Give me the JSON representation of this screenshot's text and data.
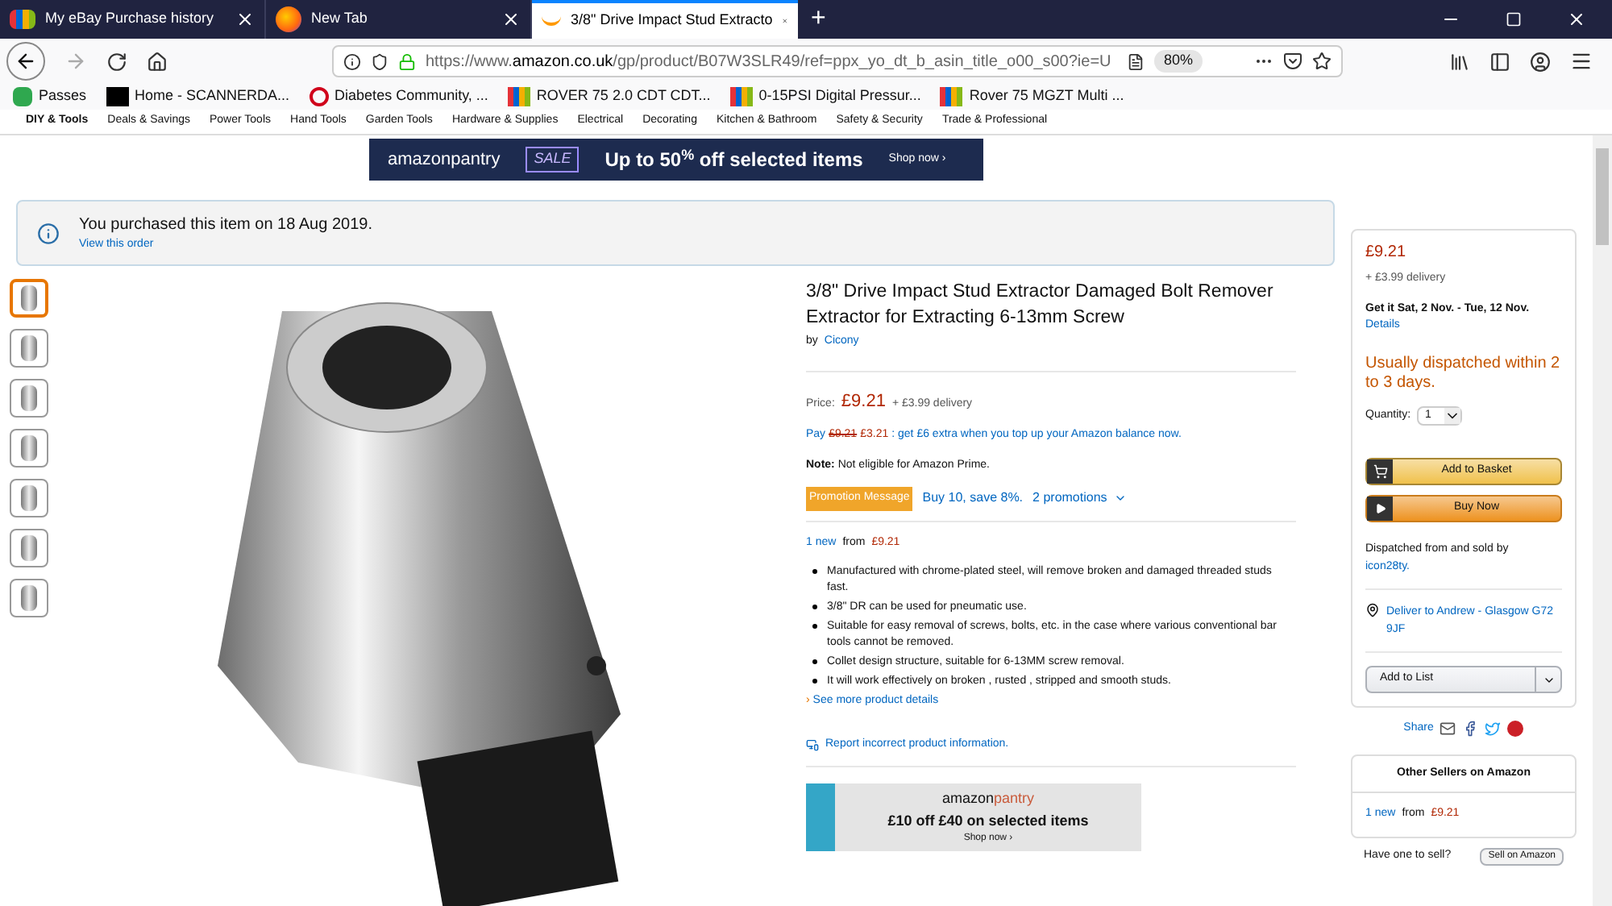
{
  "browser": {
    "tabs": [
      {
        "title": "My eBay Purchase history",
        "selected": false,
        "kind": "ebay"
      },
      {
        "title": "New Tab",
        "selected": false,
        "kind": "firefox"
      },
      {
        "title": "3/8\" Drive Impact Stud Extracto",
        "selected": true,
        "kind": "amazon"
      }
    ],
    "new_tab": "+",
    "url_prefix": "https://www.",
    "url_domain": "amazon.co.uk",
    "url_rest": "/gp/product/B07W3SLR49/ref=ppx_yo_dt_b_asin_title_o00_s00?ie=U",
    "zoom": "80%",
    "bookmarks": [
      {
        "label": "Passes",
        "kind": "n"
      },
      {
        "label": "Home - SCANNERDA...",
        "kind": "sc"
      },
      {
        "label": "Diabetes Community, ...",
        "kind": "bug"
      },
      {
        "label": "ROVER 75 2.0 CDT CDT...",
        "kind": "ebay"
      },
      {
        "label": "0-15PSI Digital Pressur...",
        "kind": "ebay"
      },
      {
        "label": "Rover 75 MGZT Multi ...",
        "kind": "ebay"
      }
    ]
  },
  "category_nav": [
    {
      "label": "DIY & Tools",
      "bold": true
    },
    {
      "label": "Deals & Savings",
      "bold": false
    },
    {
      "label": "Power Tools",
      "bold": false
    },
    {
      "label": "Hand Tools",
      "bold": false
    },
    {
      "label": "Garden Tools",
      "bold": false
    },
    {
      "label": "Hardware & Supplies",
      "bold": false
    },
    {
      "label": "Electrical",
      "bold": false
    },
    {
      "label": "Decorating",
      "bold": false
    },
    {
      "label": "Kitchen & Bathroom",
      "bold": false
    },
    {
      "label": "Safety & Security",
      "bold": false
    },
    {
      "label": "Trade & Professional",
      "bold": false
    }
  ],
  "banner": {
    "brand": "amazonpantry",
    "tag": "SALE",
    "headline": "Up to 50$^{%}$ off selected items",
    "cta": "Shop now ›"
  },
  "notice": {
    "text": "You purchased this item on 18 Aug 2019.",
    "link": "View this order"
  },
  "thumbnails": [
    {
      "selected": true
    },
    {
      "selected": false
    },
    {
      "selected": false
    },
    {
      "selected": false
    },
    {
      "selected": false
    },
    {
      "selected": false
    },
    {
      "selected": false
    }
  ],
  "product": {
    "title": "3/8\" Drive Impact Stud Extractor Damaged Bolt Remover Extractor for Extracting 6-13mm Screw",
    "by": "by",
    "brand": "Cicony",
    "price_label": "Price:",
    "price": "£9.21",
    "delivery": "+ £3.99 delivery",
    "pay_label": "Pay",
    "pay_old": "£9.21",
    "pay_new": "£3.21",
    "pay_rest": ": get £6 extra when you top up your Amazon balance now.",
    "note": "**Note:** Not eligible for Amazon Prime.",
    "promo_badge": "Promotion Message",
    "promo_text": "Buy 10, save 8%.",
    "promo_link": "2 promotions",
    "offers_link": "1 new",
    "offers_from": "from",
    "offers_price": "£9.21",
    "bullets": [
      "Manufactured with chrome-plated steel, will remove broken and damaged threaded studs fast.",
      "3/8\" DR can be used for pneumatic use.",
      "Suitable for easy removal of screws, bolts, etc. in the case where various conventional bar tools cannot be removed.",
      "Collet design structure, suitable for 6-13MM screw removal.",
      "It will work effectively on broken , rusted , stripped and smooth studs."
    ],
    "see_more_mark": "›",
    "see_more": "See more product details",
    "report": "Report incorrect product information."
  },
  "pantry_ad": {
    "brand_a": "amazon",
    "brand_b": "pantry",
    "headline": "£10 off £40 on selected items",
    "cta": "Shop now ›"
  },
  "buybox": {
    "price": "£9.21",
    "delivery": "+ £3.99 delivery",
    "get_it": "Get it Sat, 2 Nov. - Tue, 12 Nov.",
    "details": "Details",
    "availability": "Usually dispatched within 2 to 3 days.",
    "quantity_label": "Quantity:",
    "quantity": "1",
    "add_to_basket": "Add to Basket",
    "buy_now": "Buy Now",
    "sold_by": "Dispatched from and sold by",
    "seller": "icon28ty.",
    "deliver_to": "Deliver to Andrew - Glasgow G72 9JF",
    "add_to_list": "Add to List"
  },
  "share": "Share",
  "other_sellers": {
    "title": "Other Sellers on Amazon",
    "link": "1 new",
    "from": "from",
    "price": "£9.21"
  },
  "sell": {
    "question": "Have one to sell?",
    "button": "Sell on Amazon"
  }
}
